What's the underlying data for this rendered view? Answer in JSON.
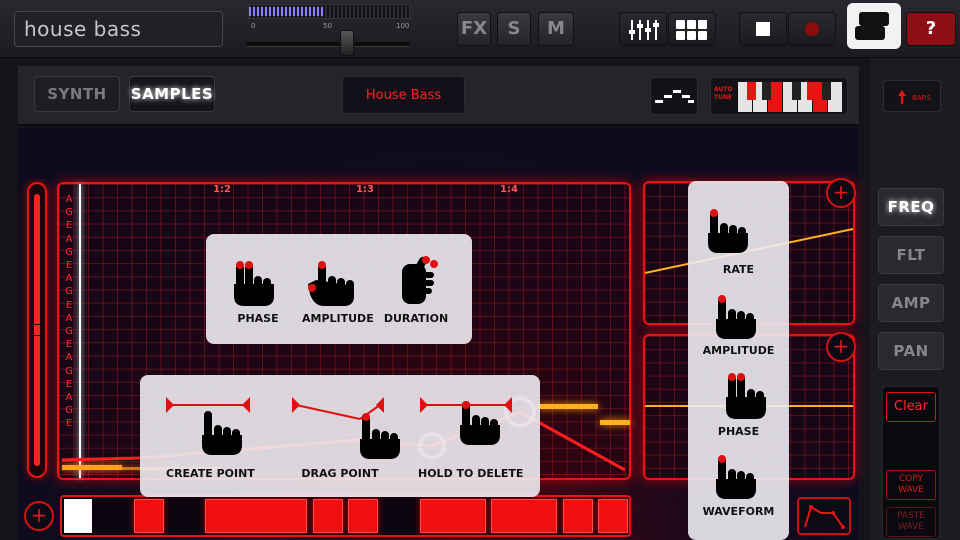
{
  "header": {
    "preset_name": "house bass",
    "meter_scale": [
      "0",
      "50",
      "100"
    ],
    "meter_level": 0.47,
    "fx_label": "FX",
    "solo_label": "S",
    "mute_label": "M",
    "help_label": "?"
  },
  "tabs": {
    "synth": "SYNTH",
    "samples": "SAMPLES",
    "active": "SAMPLES"
  },
  "preset_display": "House Bass",
  "autotune_label": "AUTO TUNE",
  "bars_label": "BARS",
  "bar_markers": [
    "1:2",
    "1:3",
    "1:4"
  ],
  "note_labels": [
    "A",
    "G",
    "E",
    "A",
    "G",
    "E",
    "A",
    "G",
    "E",
    "A",
    "G",
    "E",
    "A",
    "G",
    "E",
    "A",
    "G",
    "E"
  ],
  "gesture_card_top": {
    "items": [
      "PHASE",
      "AMPLITUDE",
      "DURATION"
    ]
  },
  "gesture_card_bottom": {
    "items": [
      "CREATE POINT",
      "DRAG POINT",
      "HOLD TO DELETE"
    ]
  },
  "gesture_card_right": {
    "items": [
      "RATE",
      "AMPLITUDE",
      "PHASE",
      "WAVEFORM"
    ]
  },
  "side_tabs": {
    "freq": "FREQ",
    "flt": "FLT",
    "amp": "AMP",
    "pan": "PAN",
    "active": "FREQ"
  },
  "wave_buttons": {
    "clear": "Clear",
    "copy": "COPY WAVE",
    "paste": "PASTE WAVE"
  },
  "colors": {
    "accent": "#e81414",
    "background": "#0e0b1e",
    "meter": "#8a7cff"
  }
}
